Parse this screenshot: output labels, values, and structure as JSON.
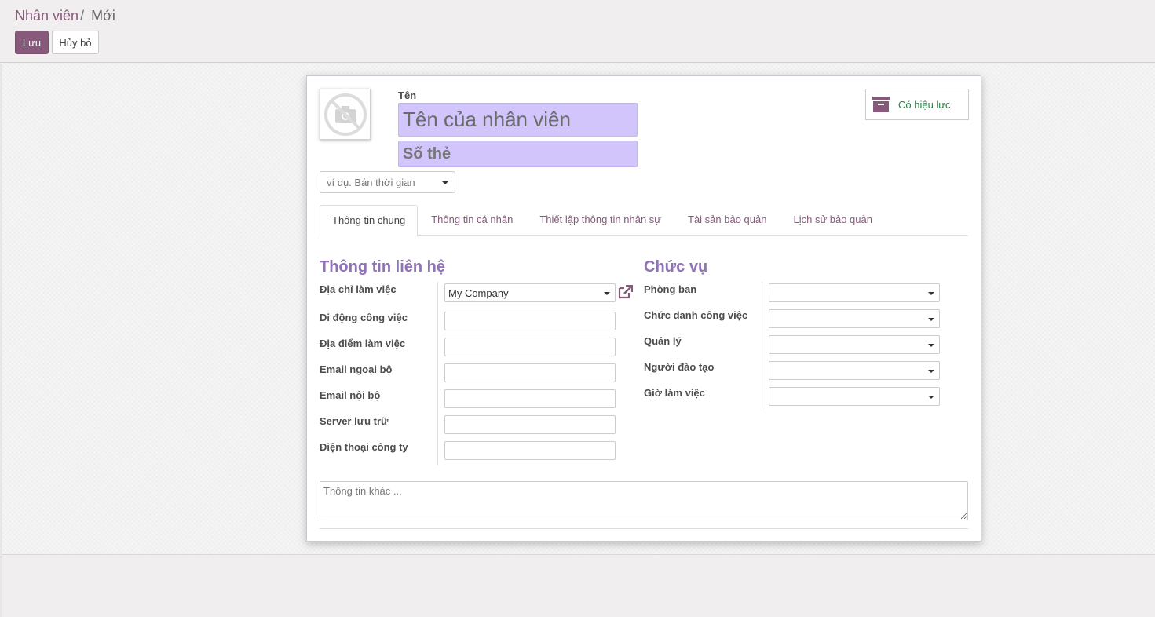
{
  "breadcrumb": {
    "parent": "Nhân viên",
    "separator": "/",
    "current": "Mới"
  },
  "buttons": {
    "save": "Lưu",
    "discard": "Hủy bỏ"
  },
  "header": {
    "name_label": "Tên",
    "name_placeholder": "Tên của nhân viên",
    "badge_placeholder": "Số thẻ",
    "active_button": "Có hiệu lực",
    "employee_type_placeholder": "ví dụ. Bán thời gian"
  },
  "tabs": [
    {
      "label": "Thông tin chung",
      "active": true
    },
    {
      "label": "Thông tin cá nhân",
      "active": false
    },
    {
      "label": "Thiết lập thông tin nhân sự",
      "active": false
    },
    {
      "label": "Tài sản bảo quản",
      "active": false
    },
    {
      "label": "Lịch sử bảo quản",
      "active": false
    }
  ],
  "contact": {
    "title": "Thông tin liên hệ",
    "fields": [
      {
        "label": "Địa chỉ làm việc",
        "value": "My Company"
      },
      {
        "label": "Di động công việc",
        "value": ""
      },
      {
        "label": "Địa điểm làm việc",
        "value": ""
      },
      {
        "label": "Email ngoại bộ",
        "value": ""
      },
      {
        "label": "Email nội bộ",
        "value": ""
      },
      {
        "label": "Server lưu trữ",
        "value": ""
      },
      {
        "label": "Điện thoại công ty",
        "value": ""
      }
    ]
  },
  "position": {
    "title": "Chức vụ",
    "fields": [
      {
        "label": "Phòng ban",
        "value": ""
      },
      {
        "label": "Chức danh công việc",
        "value": ""
      },
      {
        "label": "Quản lý",
        "value": ""
      },
      {
        "label": "Người đào tạo",
        "value": ""
      },
      {
        "label": "Giờ làm việc",
        "value": ""
      }
    ]
  },
  "notes_placeholder": "Thông tin khác ...",
  "colors": {
    "primary": "#875a7b",
    "name_field_bg": "#d2c5fb",
    "active_text": "#1e8a3b",
    "section_title": "#8f72b8"
  },
  "icons": {
    "avatar": "camera-placeholder-icon",
    "active": "archive-box-icon",
    "external": "external-link-icon"
  }
}
